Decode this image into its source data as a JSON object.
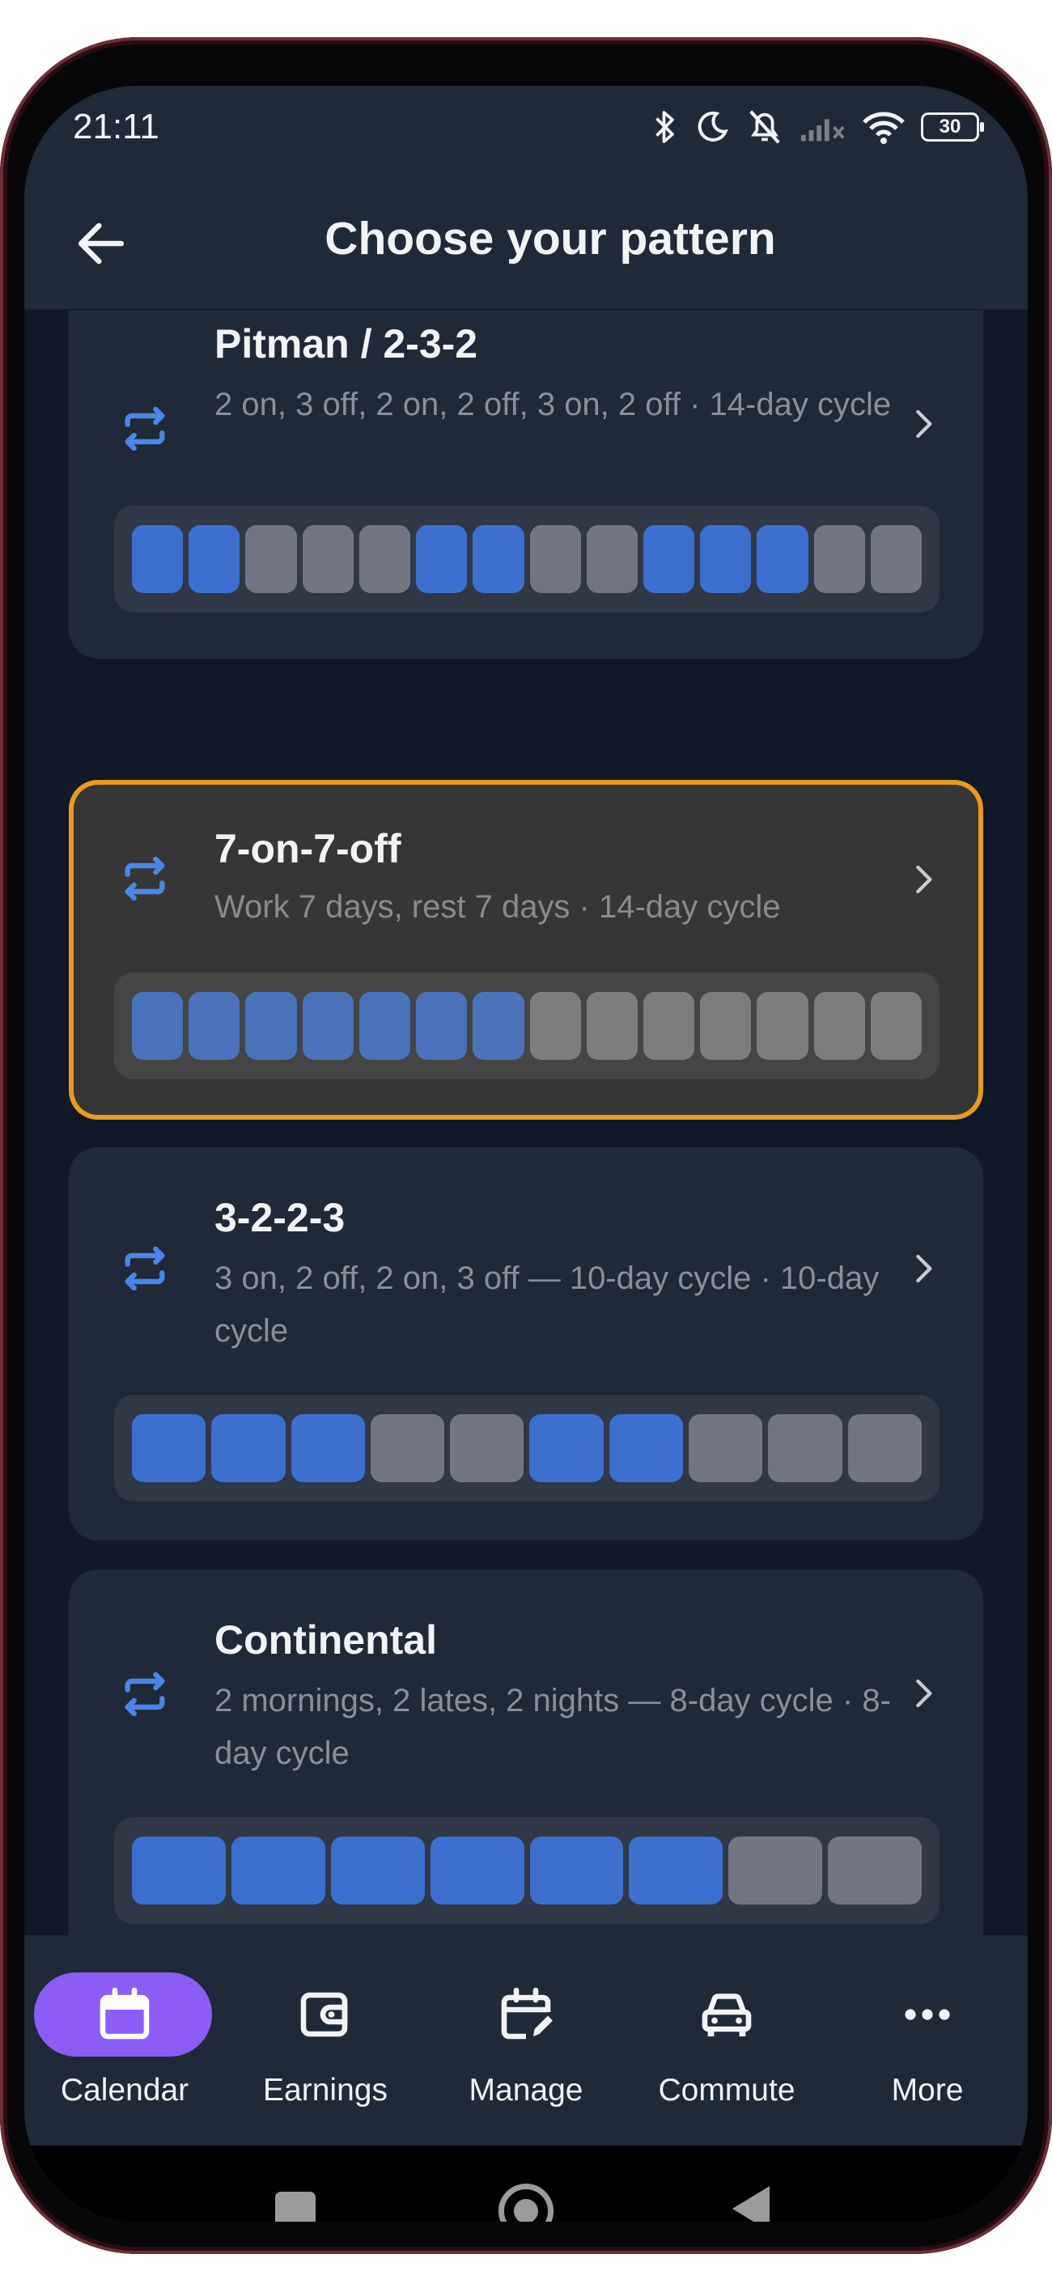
{
  "status_bar": {
    "time": "21:11",
    "battery": "30"
  },
  "header": {
    "title": "Choose your pattern"
  },
  "colors": {
    "work_day": "#3b6fcf",
    "off_day": "#717682",
    "selected_border": "#e89b1d",
    "nav_active_pill": "#8b5cf6"
  },
  "patterns": [
    {
      "title": "Pitman / 2-3-2",
      "description": "2 on, 3 off, 2 on, 2 off, 3 on, 2 off · 14-day cycle",
      "icon": "repeat-icon",
      "days": [
        1,
        1,
        0,
        0,
        0,
        1,
        1,
        0,
        0,
        1,
        1,
        1,
        0,
        0
      ]
    },
    {
      "title": "7-on-7-off",
      "description": "Work 7 days, rest 7 days · 14-day cycle",
      "icon": "repeat-icon",
      "selected": true,
      "days": [
        1,
        1,
        1,
        1,
        1,
        1,
        1,
        0,
        0,
        0,
        0,
        0,
        0,
        0
      ]
    },
    {
      "title": "3-2-2-3",
      "description": "3 on, 2 off, 2 on, 3 off — 10-day cycle · 10-day cycle",
      "icon": "repeat-icon",
      "days": [
        1,
        1,
        1,
        0,
        0,
        1,
        1,
        0,
        0,
        0
      ]
    },
    {
      "title": "Continental",
      "description": "2 mornings, 2 lates, 2 nights — 8-day cycle · 8-day cycle",
      "icon": "repeat-icon",
      "days": [
        1,
        1,
        1,
        1,
        1,
        1,
        0,
        0
      ]
    }
  ],
  "nav": {
    "items": [
      {
        "label": "Calendar",
        "icon": "calendar-icon",
        "active": true
      },
      {
        "label": "Earnings",
        "icon": "wallet-icon"
      },
      {
        "label": "Manage",
        "icon": "calendar-edit-icon"
      },
      {
        "label": "Commute",
        "icon": "car-icon"
      },
      {
        "label": "More",
        "icon": "more-icon"
      }
    ]
  }
}
